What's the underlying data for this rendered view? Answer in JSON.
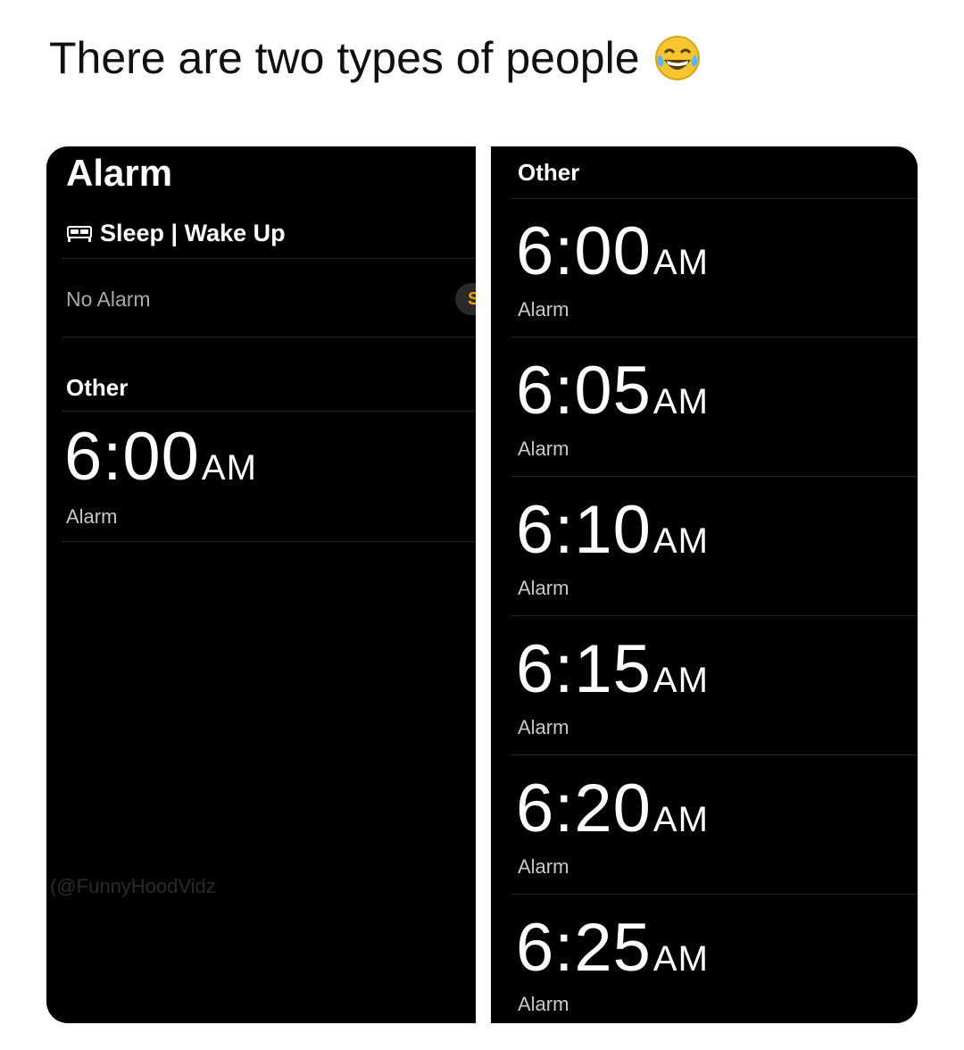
{
  "caption": {
    "text": "There are two types of people"
  },
  "left": {
    "title": "Alarm",
    "sleep_label": "Sleep | Wake Up",
    "no_alarm": "No Alarm",
    "set_button": "S",
    "other_heading": "Other",
    "alarm": {
      "time": "6:00",
      "ampm": "AM",
      "label": "Alarm"
    },
    "watermark": "(@FunnyHoodVidz"
  },
  "right": {
    "other_heading": "Other",
    "alarms": [
      {
        "time": "6:00",
        "ampm": "AM",
        "label": "Alarm"
      },
      {
        "time": "6:05",
        "ampm": "AM",
        "label": "Alarm"
      },
      {
        "time": "6:10",
        "ampm": "AM",
        "label": "Alarm"
      },
      {
        "time": "6:15",
        "ampm": "AM",
        "label": "Alarm"
      },
      {
        "time": "6:20",
        "ampm": "AM",
        "label": "Alarm"
      },
      {
        "time": "6:25",
        "ampm": "AM",
        "label": "Alarm"
      }
    ]
  },
  "icons": {
    "caption_emoji": "tears-of-joy-emoji",
    "sleep_icon": "bed-icon"
  },
  "colors": {
    "background": "#ffffff",
    "panel": "#000000",
    "accent": "#ff9f0a"
  }
}
